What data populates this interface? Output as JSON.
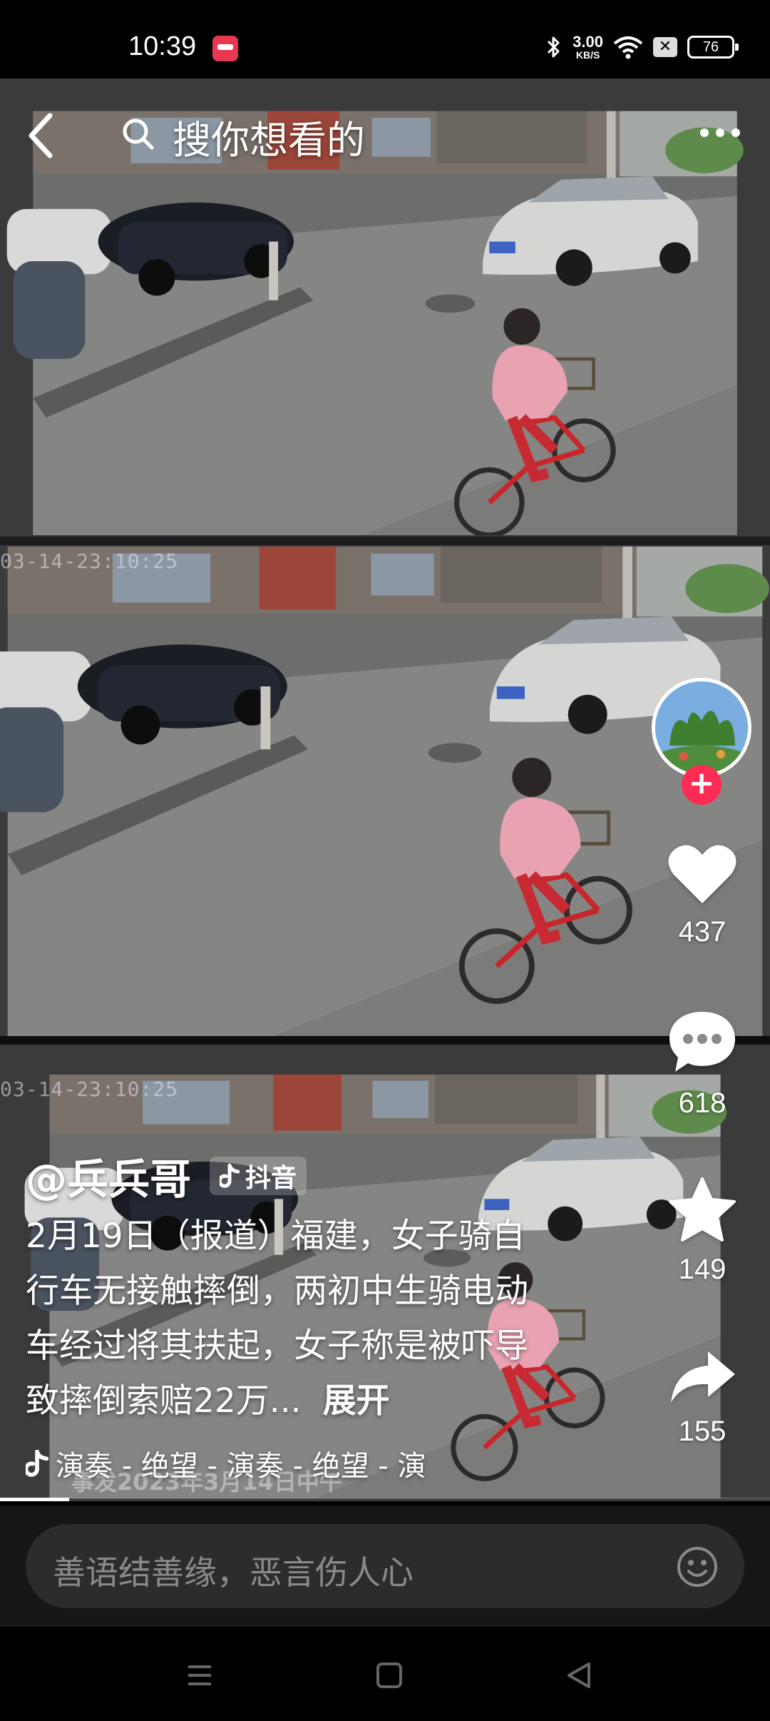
{
  "status_bar": {
    "time": "10:39",
    "net_speed_value": "3.00",
    "net_speed_unit": "KB/S",
    "battery": "76",
    "icons": [
      "app-indicator-icon",
      "bluetooth-icon",
      "wifi-icon",
      "sim-off-icon",
      "battery-icon"
    ]
  },
  "search": {
    "placeholder": "搜你想看的"
  },
  "video": {
    "camera_timestamp": "03-14-23:10:25",
    "overlay_subtitle": "事发2023年3月14日中午"
  },
  "actions": {
    "likes": "437",
    "comments": "618",
    "favorites": "149",
    "shares": "155",
    "follow_symbol": "+"
  },
  "post": {
    "author": "@兵兵哥",
    "platform": "抖音",
    "caption": "2月19日（报道）福建，女子骑自行车无接触摔倒，两初中生骑电动车经过将其扶起，女子称是被吓导致摔倒索赔22万...",
    "expand_label": "展开",
    "music": "演奏 - 绝望 - 演奏 - 绝望 - 演",
    "progress": 0.09
  },
  "comment_bar": {
    "placeholder": "善语结善缘，恶言伤人心"
  },
  "colors": {
    "accent": "#fe2c55",
    "background": "#000000",
    "comment_bar": "#161616",
    "comment_input": "#2c2c2e"
  }
}
